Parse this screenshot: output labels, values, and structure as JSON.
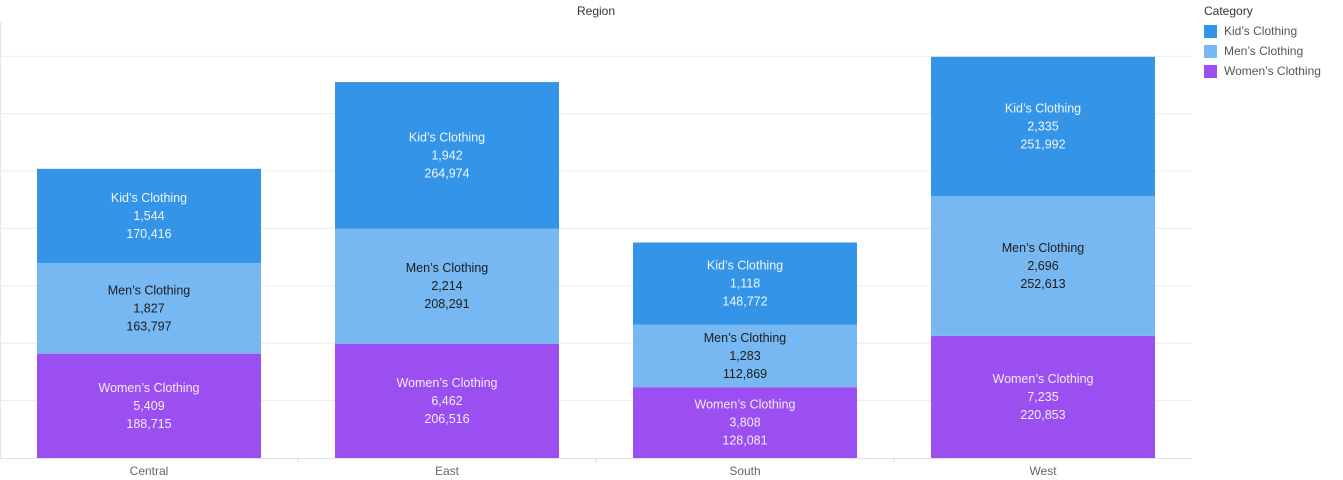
{
  "chart_data": {
    "type": "bar",
    "stacked": true,
    "title": "Region",
    "categories": [
      "Central",
      "East",
      "South",
      "West"
    ],
    "series": [
      {
        "name": "Women’s Clothing",
        "color": "#9b4ff0",
        "label_color": "#f4ebff",
        "values": [
          188715,
          206516,
          128081,
          220853
        ],
        "quantities": [
          5409,
          6462,
          3808,
          7235
        ]
      },
      {
        "name": "Men’s Clothing",
        "color": "#77b8f3",
        "label_color": "#1c1c1c",
        "values": [
          163797,
          208291,
          112869,
          252613
        ],
        "quantities": [
          1827,
          2214,
          1283,
          2696
        ]
      },
      {
        "name": "Kid’s Clothing",
        "color": "#3495e8",
        "label_color": "#eef6ff",
        "values": [
          170416,
          264974,
          148772,
          251992
        ],
        "quantities": [
          1544,
          1942,
          1118,
          2335
        ]
      }
    ],
    "ylim": [
      0,
      755000
    ],
    "grid": true,
    "legend_title": "Category",
    "legend_order": [
      "Kid’s Clothing",
      "Men’s Clothing",
      "Women’s Clothing"
    ],
    "legend_placement": "top-right"
  }
}
